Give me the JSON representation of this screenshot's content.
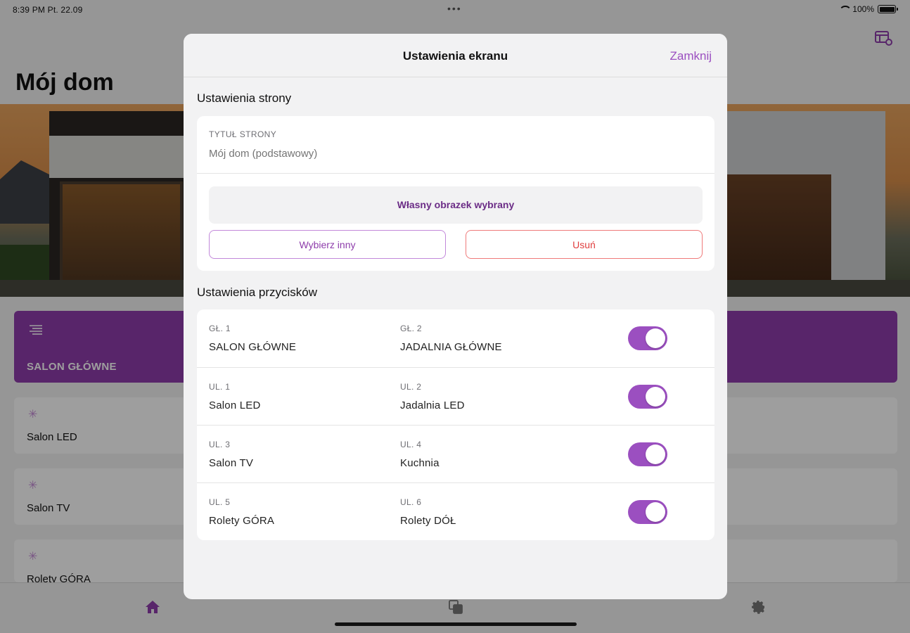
{
  "status_bar": {
    "time_date": "8:39 PM  Pt. 22.09",
    "dots": "•••",
    "battery": "100%"
  },
  "app": {
    "title": "Mój dom",
    "main_tile": {
      "label": "SALON GŁÓWNE",
      "icon": "hamburger-icon"
    },
    "tiles": [
      {
        "label": "Salon LED",
        "icon": "sparkle-icon"
      },
      {
        "label": "Salon TV",
        "icon": "sparkle-icon"
      },
      {
        "label": "Rolety GÓRA",
        "icon": "sparkle-icon"
      }
    ],
    "tab_bar": {
      "icons": [
        "home-icon",
        "copy-icon",
        "gear-icon"
      ],
      "accent": "#8e3dab"
    }
  },
  "modal": {
    "title": "Ustawienia ekranu",
    "close_label": "Zamknij",
    "page_settings": {
      "section_title": "Ustawienia strony",
      "field_label": "TYTUŁ STRONY",
      "field_placeholder": "Mój dom (podstawowy)",
      "image_status": "Własny obrazek wybrany",
      "choose_other_label": "Wybierz inny",
      "remove_label": "Usuń"
    },
    "button_settings": {
      "section_title": "Ustawienia przycisków",
      "rows": [
        {
          "left_id": "GŁ. 1",
          "left_name": "SALON GŁÓWNE",
          "right_id": "GŁ. 2",
          "right_name": "JADALNIA GŁÓWNE",
          "enabled": true
        },
        {
          "left_id": "UL. 1",
          "left_name": "Salon LED",
          "right_id": "UL. 2",
          "right_name": "Jadalnia LED",
          "enabled": true
        },
        {
          "left_id": "UL. 3",
          "left_name": "Salon TV",
          "right_id": "UL. 4",
          "right_name": "Kuchnia",
          "enabled": true
        },
        {
          "left_id": "UL. 5",
          "left_name": "Rolety GÓRA",
          "right_id": "UL. 6",
          "right_name": "Rolety DÓŁ",
          "enabled": true
        }
      ]
    }
  },
  "colors": {
    "accent": "#8e3dab",
    "toggle_on": "#9b4fc0",
    "remove": "#e03e3e"
  }
}
